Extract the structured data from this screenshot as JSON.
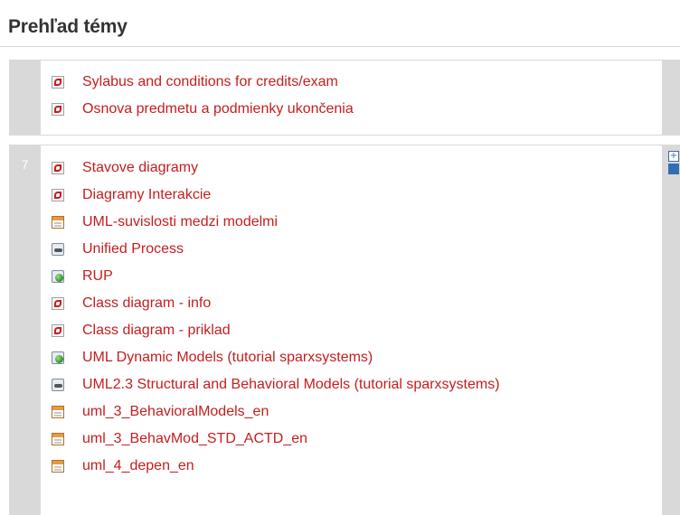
{
  "page_title": "Prehľad témy",
  "sections": [
    {
      "number": "",
      "items": [
        {
          "label": "Sylabus and conditions for credits/exam",
          "icon": "pdf-icon"
        },
        {
          "label": "Osnova predmetu a podmienky ukončenia",
          "icon": "pdf-icon"
        }
      ]
    },
    {
      "number": "7",
      "items": [
        {
          "label": "Stavove diagramy",
          "icon": "pdf-icon"
        },
        {
          "label": "Diagramy Interakcie",
          "icon": "pdf-icon"
        },
        {
          "label": "UML-suvislosti medzi modelmi",
          "icon": "presentation-icon"
        },
        {
          "label": "Unified Process",
          "icon": "link-icon"
        },
        {
          "label": "RUP",
          "icon": "web-link-icon"
        },
        {
          "label": "Class diagram - info",
          "icon": "pdf-icon"
        },
        {
          "label": "Class diagram - priklad",
          "icon": "pdf-icon"
        },
        {
          "label": "UML Dynamic Models (tutorial sparxsystems)",
          "icon": "web-link-icon"
        },
        {
          "label": "UML2.3 Structural and Behavioral Models (tutorial sparxsystems)",
          "icon": "link-icon"
        },
        {
          "label": "uml_3_BehavioralModels_en",
          "icon": "presentation-icon"
        },
        {
          "label": "uml_3_BehavMod_STD_ACTD_en",
          "icon": "presentation-icon"
        },
        {
          "label": "uml_4_depen_en",
          "icon": "presentation-icon"
        }
      ]
    }
  ],
  "side_controls": {
    "show_only_label": "+"
  },
  "colors": {
    "link": "#c41e1e",
    "section_bg": "#d9d9d9",
    "title": "#333333"
  }
}
